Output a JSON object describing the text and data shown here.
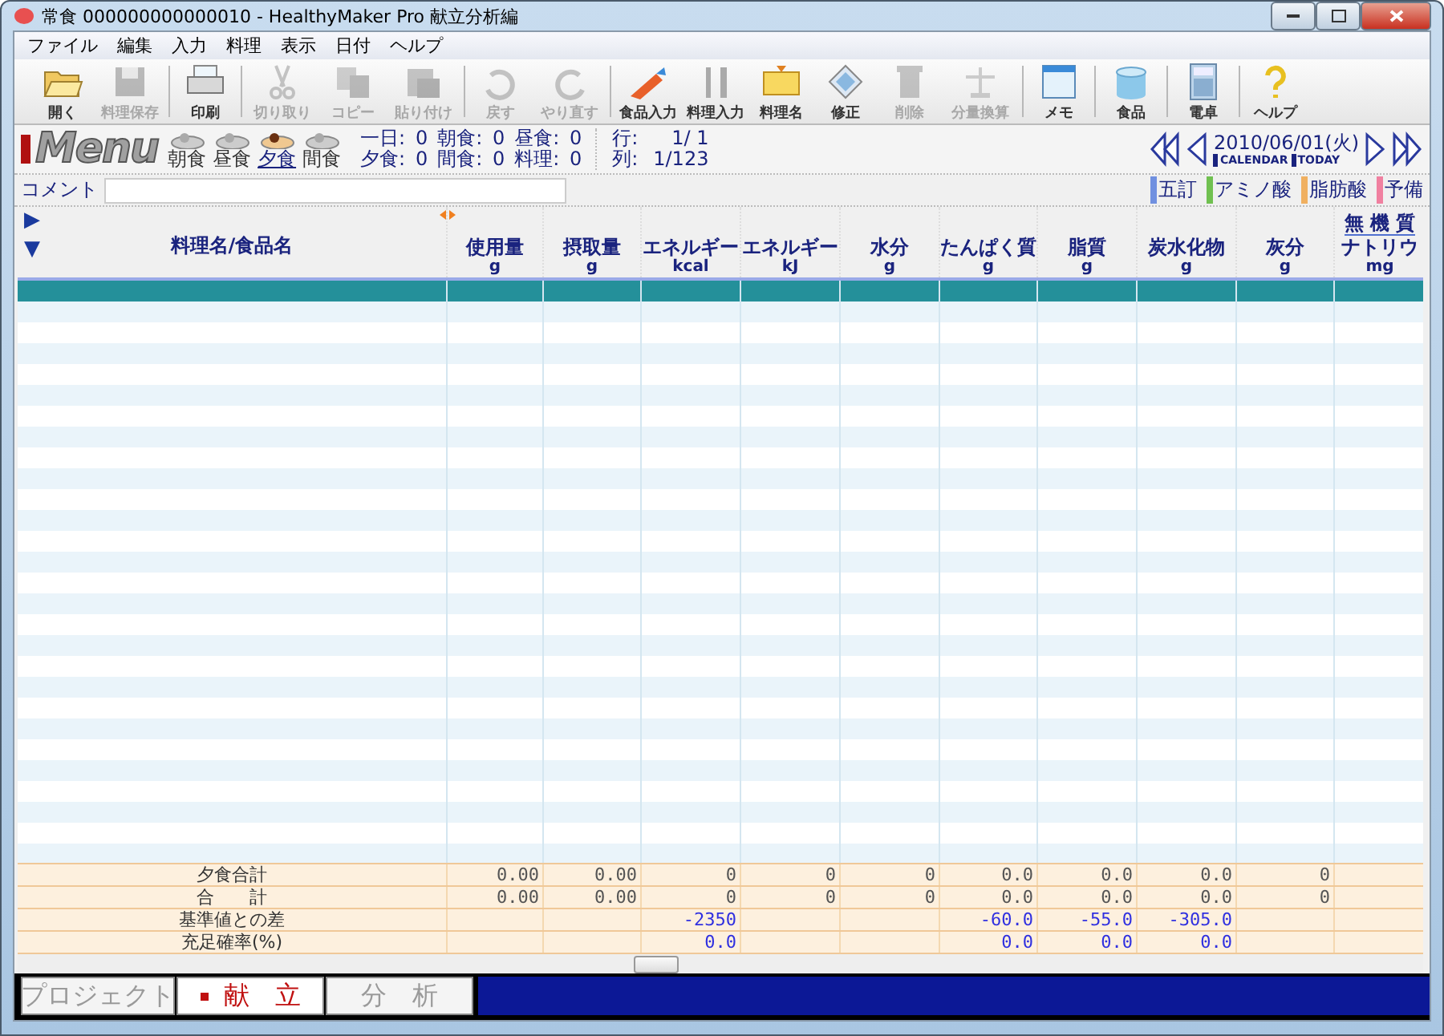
{
  "window": {
    "title": "常食 000000000000010 - HealthyMaker Pro 献立分析編"
  },
  "menu": [
    "ファイル",
    "編集",
    "入力",
    "料理",
    "表示",
    "日付",
    "ヘルプ"
  ],
  "toolbar": [
    {
      "label": "開く",
      "disabled": false,
      "separator_after": false
    },
    {
      "label": "料理保存",
      "disabled": true,
      "separator_after": true
    },
    {
      "label": "印刷",
      "disabled": false,
      "separator_after": true
    },
    {
      "label": "切り取り",
      "disabled": true,
      "separator_after": false
    },
    {
      "label": "コピー",
      "disabled": true,
      "separator_after": false
    },
    {
      "label": "貼り付け",
      "disabled": true,
      "separator_after": true
    },
    {
      "label": "戻す",
      "disabled": true,
      "separator_after": false
    },
    {
      "label": "やり直す",
      "disabled": true,
      "separator_after": true
    },
    {
      "label": "食品入力",
      "disabled": false,
      "separator_after": false
    },
    {
      "label": "料理入力",
      "disabled": false,
      "separator_after": false
    },
    {
      "label": "料理名",
      "disabled": false,
      "separator_after": false
    },
    {
      "label": "修正",
      "disabled": false,
      "separator_after": false
    },
    {
      "label": "削除",
      "disabled": true,
      "separator_after": false
    },
    {
      "label": "分量換算",
      "disabled": true,
      "separator_after": true
    },
    {
      "label": "メモ",
      "disabled": false,
      "separator_after": true
    },
    {
      "label": "食品",
      "disabled": false,
      "separator_after": true
    },
    {
      "label": "電卓",
      "disabled": false,
      "separator_after": true
    },
    {
      "label": "ヘルプ",
      "disabled": false,
      "separator_after": false
    }
  ],
  "logo": "Menu",
  "meals": [
    {
      "label": "朝食",
      "selected": false
    },
    {
      "label": "昼食",
      "selected": false
    },
    {
      "label": "夕食",
      "selected": true
    },
    {
      "label": "間食",
      "selected": false
    }
  ],
  "counts": [
    [
      {
        "label": "一日:",
        "value": "0"
      },
      {
        "label": "朝食:",
        "value": "0"
      },
      {
        "label": "昼食:",
        "value": "0"
      }
    ],
    [
      {
        "label": "夕食:",
        "value": "0"
      },
      {
        "label": "間食:",
        "value": "0"
      },
      {
        "label": "料理:",
        "value": "0"
      }
    ]
  ],
  "position": [
    {
      "label": "行:",
      "value": "1/ 1"
    },
    {
      "label": "列:",
      "value": "1/123"
    }
  ],
  "date": {
    "text": "2010/06/01(火)",
    "links": [
      "CALENDAR",
      "TODAY"
    ]
  },
  "comment": {
    "label": "コメント"
  },
  "legend": [
    {
      "label": "五訂",
      "color": "#7090e0"
    },
    {
      "label": "アミノ酸",
      "color": "#70c050"
    },
    {
      "label": "脂肪酸",
      "color": "#f0b060"
    },
    {
      "label": "予備",
      "color": "#f080a0"
    }
  ],
  "row_arrows": [
    "▶",
    "▼"
  ],
  "table": {
    "name_column": "料理名/食品名",
    "columns": [
      {
        "name": "使用量",
        "unit": "g"
      },
      {
        "name": "摂取量",
        "unit": "g"
      },
      {
        "name": "エネルギー",
        "unit": "kcal"
      },
      {
        "name": "エネルギー",
        "unit": "kJ"
      },
      {
        "name": "水分",
        "unit": "g"
      },
      {
        "name": "たんぱく質",
        "unit": "g"
      },
      {
        "name": "脂質",
        "unit": "g"
      },
      {
        "name": "炭水化物",
        "unit": "g"
      },
      {
        "name": "灰分",
        "unit": "g"
      },
      {
        "name": "ナトリウ",
        "unit": "mg",
        "group": "無 機 質"
      }
    ],
    "rows": [
      {
        "selected": true
      },
      {
        "selected": false
      },
      {
        "selected": false
      },
      {
        "selected": false
      },
      {
        "selected": false
      },
      {
        "selected": false
      },
      {
        "selected": false
      },
      {
        "selected": false
      },
      {
        "selected": false
      },
      {
        "selected": false
      },
      {
        "selected": false
      },
      {
        "selected": false
      },
      {
        "selected": false
      },
      {
        "selected": false
      },
      {
        "selected": false
      },
      {
        "selected": false
      },
      {
        "selected": false
      },
      {
        "selected": false
      },
      {
        "selected": false
      },
      {
        "selected": false
      },
      {
        "selected": false
      },
      {
        "selected": false
      },
      {
        "selected": false
      },
      {
        "selected": false
      },
      {
        "selected": false
      },
      {
        "selected": false
      },
      {
        "selected": false
      },
      {
        "selected": false
      }
    ],
    "summary": [
      {
        "label": "夕食合計",
        "kind": "total",
        "values": {
          "col_1": "0.00",
          "col_2": "0.00",
          "col_3": "0",
          "col_4": "0",
          "col_5": "0",
          "col_6": "0.0",
          "col_7": "0.0",
          "col_8": "0.0",
          "col_9": "0"
        }
      },
      {
        "label": "合　　計",
        "kind": "total",
        "values": {
          "col_1": "0.00",
          "col_2": "0.00",
          "col_3": "0",
          "col_4": "0",
          "col_5": "0",
          "col_6": "0.0",
          "col_7": "0.0",
          "col_8": "0.0",
          "col_9": "0"
        }
      },
      {
        "label": "基準値との差",
        "kind": "reference",
        "values": {
          "col_3": "-2350",
          "col_6": "-60.0",
          "col_7": "-55.0",
          "col_8": "-305.0"
        }
      },
      {
        "label": "充足確率(%)",
        "kind": "reference",
        "values": {
          "col_3": "0.0",
          "col_6": "0.0",
          "col_7": "0.0",
          "col_8": "0.0"
        }
      }
    ]
  },
  "bottom_tabs": [
    {
      "label": "プロジェクト",
      "selected": false
    },
    {
      "label": "献　立",
      "selected": true
    },
    {
      "label": "分　析",
      "selected": false
    }
  ]
}
